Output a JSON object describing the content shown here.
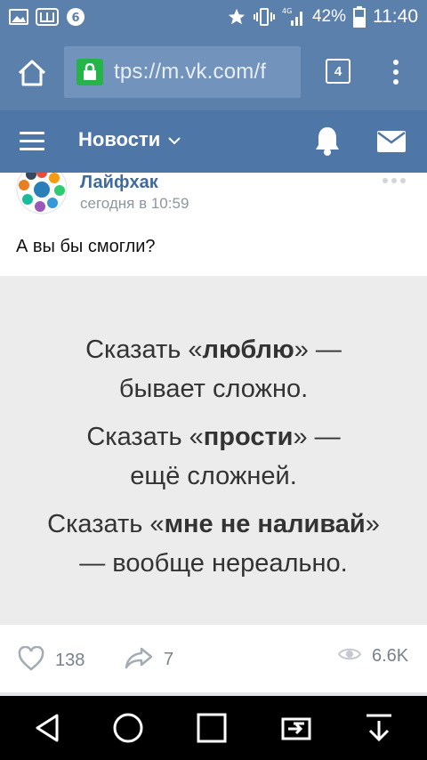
{
  "status_bar": {
    "battery_percent": "42%",
    "time": "11:40",
    "network": "4G"
  },
  "browser": {
    "url": "tps://m.vk.com/f",
    "tab_count": "4"
  },
  "header": {
    "title": "Новости"
  },
  "post": {
    "author": "Лайфхак",
    "time": "сегодня в 10:59",
    "text": "А вы бы смогли?",
    "image_lines": [
      {
        "pre": "Сказать «",
        "bold": "люблю",
        "post": "» —"
      },
      {
        "pre": "бывает сложно.",
        "bold": "",
        "post": ""
      },
      {
        "pre": "Сказать «",
        "bold": "прости",
        "post": "» —"
      },
      {
        "pre": "ещё сложней.",
        "bold": "",
        "post": ""
      },
      {
        "pre": "Сказать «",
        "bold": "мне не наливай",
        "post": "»"
      },
      {
        "pre": "— вообще нереально.",
        "bold": "",
        "post": ""
      }
    ],
    "likes": "138",
    "shares": "7",
    "views": "6.6K"
  },
  "colors": {
    "status_bg": "#5b80ac",
    "header_bg": "#4e76a6",
    "author": "#3f6aa0",
    "lock": "#26b34a"
  },
  "icons": [
    "picture-icon",
    "sh-icon",
    "notification-icon",
    "star-icon",
    "vibrate-icon",
    "signal-icon",
    "battery-icon",
    "home-icon",
    "lock-icon",
    "overflow-menu-icon",
    "hamburger-icon",
    "chevron-down-icon",
    "bell-icon",
    "mail-icon",
    "heart-icon",
    "share-icon",
    "eye-icon",
    "back-icon",
    "home-circle-icon",
    "recents-icon",
    "screen-mirror-icon",
    "download-icon"
  ]
}
